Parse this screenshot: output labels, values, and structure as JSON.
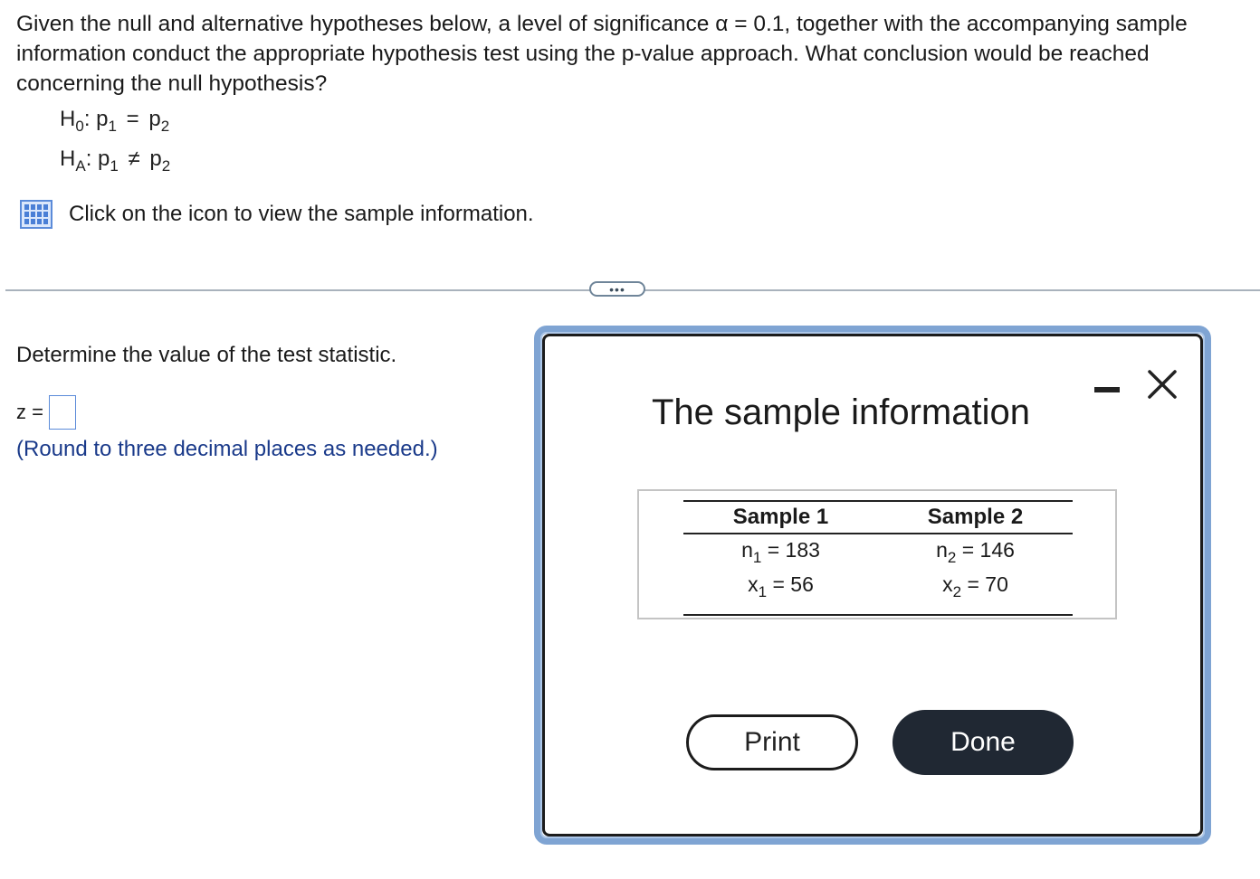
{
  "question": {
    "text": "Given the null and alternative hypotheses below, a level of significance α = 0.1, together with the accompanying sample information conduct the appropriate hypothesis test using the p-value approach. What conclusion would be reached concerning the null hypothesis?"
  },
  "hypotheses": {
    "h0": {
      "H": "H",
      "sub": "0",
      "lhs": "p",
      "lhs_sub": "1",
      "op": "=",
      "rhs": "p",
      "rhs_sub": "2"
    },
    "ha": {
      "H": "H",
      "sub": "A",
      "lhs": "p",
      "lhs_sub": "1",
      "op": "≠",
      "rhs": "p",
      "rhs_sub": "2"
    }
  },
  "info_link": {
    "icon": "table-icon",
    "text": "Click on the icon to view the sample information."
  },
  "more_button": {
    "label": "•••"
  },
  "part": {
    "prompt": "Determine the value of the test statistic.",
    "z_label": "z =",
    "z_value": "",
    "hint": "(Round to three decimal places as needed.)"
  },
  "dialog": {
    "title": "The sample information",
    "minimize_icon": "minimize-icon",
    "close_icon": "close-icon",
    "table": {
      "headers": [
        "Sample 1",
        "Sample 2"
      ],
      "n_label": "n",
      "x_label": "x",
      "sample1": {
        "n_sub": "1",
        "n_value": "183",
        "x_sub": "1",
        "x_value": "56"
      },
      "sample2": {
        "n_sub": "2",
        "n_value": "146",
        "x_sub": "2",
        "x_value": "70"
      }
    },
    "print_label": "Print",
    "done_label": "Done"
  },
  "colors": {
    "accent_blue": "#5b8bd9",
    "hint_blue": "#1a3a8a",
    "done_button": "#202833",
    "dialog_border": "#7fa4d3"
  }
}
